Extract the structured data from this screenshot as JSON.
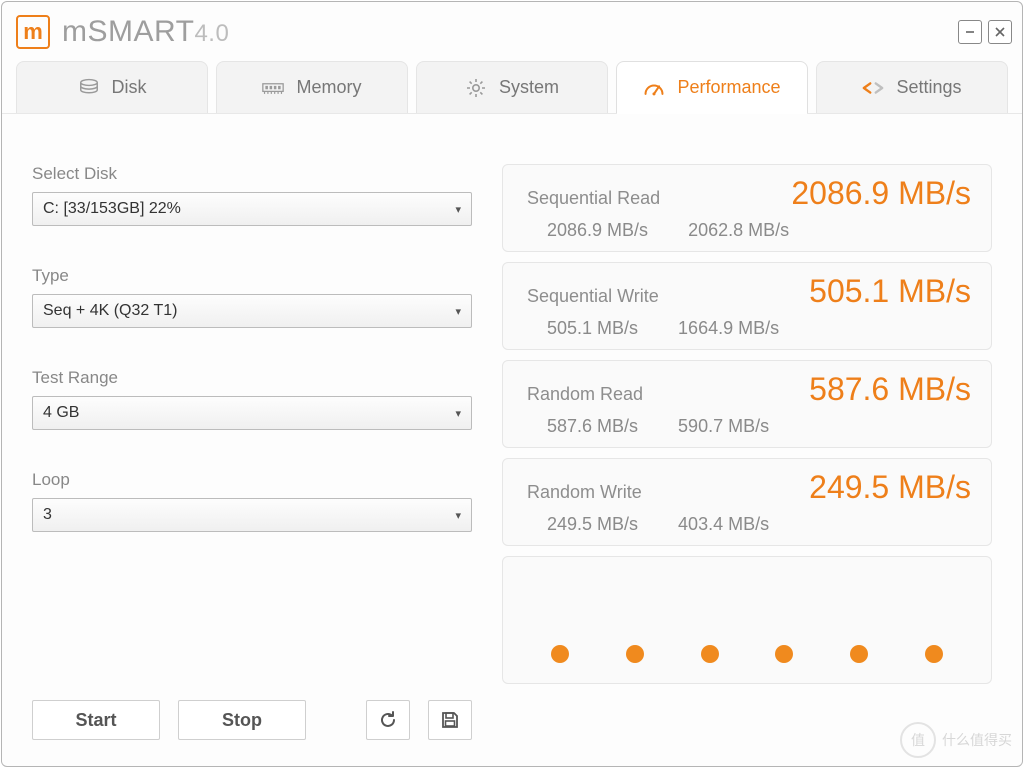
{
  "app": {
    "name": "mSMART",
    "version": "4.0"
  },
  "tabs": {
    "disk": {
      "label": "Disk"
    },
    "memory": {
      "label": "Memory"
    },
    "system": {
      "label": "System"
    },
    "performance": {
      "label": "Performance"
    },
    "settings": {
      "label": "Settings"
    }
  },
  "form": {
    "select_disk": {
      "label": "Select Disk",
      "value": "C: [33/153GB] 22%"
    },
    "type": {
      "label": "Type",
      "value": "Seq + 4K (Q32 T1)"
    },
    "test_range": {
      "label": "Test Range",
      "value": "4 GB"
    },
    "loop": {
      "label": "Loop",
      "value": "3"
    }
  },
  "buttons": {
    "start": "Start",
    "stop": "Stop"
  },
  "results": {
    "seq_read": {
      "label": "Sequential Read",
      "main": "2086.9 MB/s",
      "sub1": "2086.9 MB/s",
      "sub2": "2062.8 MB/s"
    },
    "seq_write": {
      "label": "Sequential Write",
      "main": "505.1 MB/s",
      "sub1": "505.1 MB/s",
      "sub2": "1664.9 MB/s"
    },
    "rnd_read": {
      "label": "Random Read",
      "main": "587.6 MB/s",
      "sub1": "587.6 MB/s",
      "sub2": "590.7 MB/s"
    },
    "rnd_write": {
      "label": "Random Write",
      "main": "249.5 MB/s",
      "sub1": "249.5 MB/s",
      "sub2": "403.4 MB/s"
    }
  },
  "watermark": {
    "badge": "值",
    "text": "什么值得买"
  },
  "colors": {
    "accent": "#ee7f1a"
  }
}
